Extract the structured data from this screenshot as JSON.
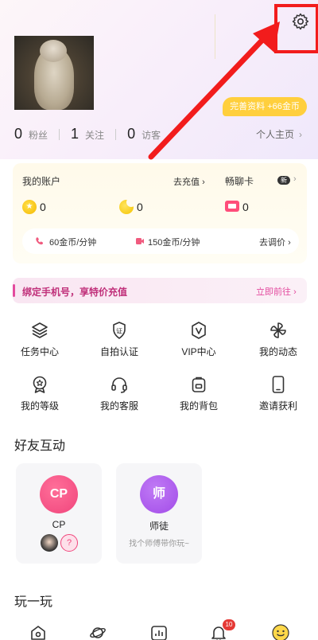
{
  "profile": {
    "complete_pill": "完善资料 +66金币",
    "stats": [
      {
        "num": "0",
        "label": "粉丝"
      },
      {
        "num": "1",
        "label": "关注"
      },
      {
        "num": "0",
        "label": "访客"
      }
    ],
    "homepage_link": "个人主页"
  },
  "account": {
    "title": "我的账户",
    "recharge_link": "去充值",
    "gold_value": "0",
    "moon_value": "0",
    "chat_card_title": "畅聊卡",
    "chat_card_badge": "新",
    "chat_card_value": "0",
    "voice_price": "60金币/分钟",
    "video_price": "150金币/分钟",
    "adjust_price_link": "去调价"
  },
  "bind_banner": {
    "text": "绑定手机号，享特价充值",
    "link": "立即前往"
  },
  "grid": [
    {
      "label": "任务中心",
      "icon": "layers-icon"
    },
    {
      "label": "自拍认证",
      "icon": "verify-icon"
    },
    {
      "label": "VIP中心",
      "icon": "vip-icon"
    },
    {
      "label": "我的动态",
      "icon": "pinwheel-icon"
    },
    {
      "label": "我的等级",
      "icon": "level-medal-icon"
    },
    {
      "label": "我的客服",
      "icon": "headset-icon"
    },
    {
      "label": "我的背包",
      "icon": "backpack-icon"
    },
    {
      "label": "邀请获利",
      "icon": "phone-icon"
    }
  ],
  "friends": {
    "title": "好友互动",
    "cards": [
      {
        "circle_text": "CP",
        "name": "CP",
        "sub": ""
      },
      {
        "circle_text": "师",
        "name": "师徒",
        "sub": "找个师傅带你玩~"
      }
    ],
    "unknown_mark": "?"
  },
  "play": {
    "title": "玩一玩"
  },
  "bottom_nav": {
    "badge": "10"
  },
  "colors": {
    "highlight": "#f21c1c",
    "gold": "#ffcf3d",
    "pink_accent": "#e34a9e",
    "cp_circle": "#f0457c",
    "mentor_circle": "#a24ce8"
  }
}
